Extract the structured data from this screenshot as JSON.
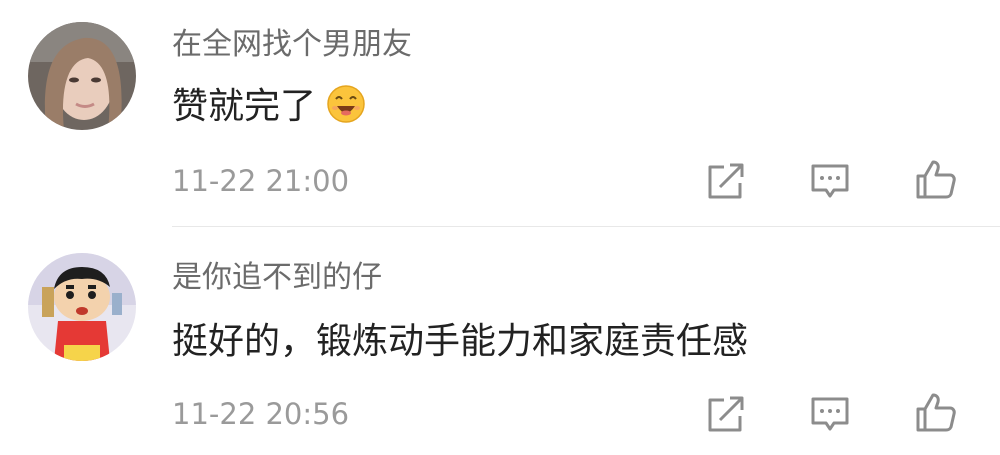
{
  "comments": [
    {
      "username": "在全网找个男朋友",
      "content": "赞就完了",
      "emoji": "grinning-face-emoji",
      "timestamp": "11-22 21:00"
    },
    {
      "username": "是你追不到的仔",
      "content": "挺好的，锻炼动手能力和家庭责任感",
      "timestamp": "11-22 20:56"
    }
  ],
  "icons": {
    "share": "share-icon",
    "reply": "comment-icon",
    "like": "thumbs-up-icon"
  },
  "colors": {
    "username": "#6b6b6b",
    "content": "#222222",
    "timestamp": "#9a9a9a",
    "icon": "#8c8c8c",
    "divider": "#e8e8e8",
    "emoji_face": "#fbc43c"
  }
}
